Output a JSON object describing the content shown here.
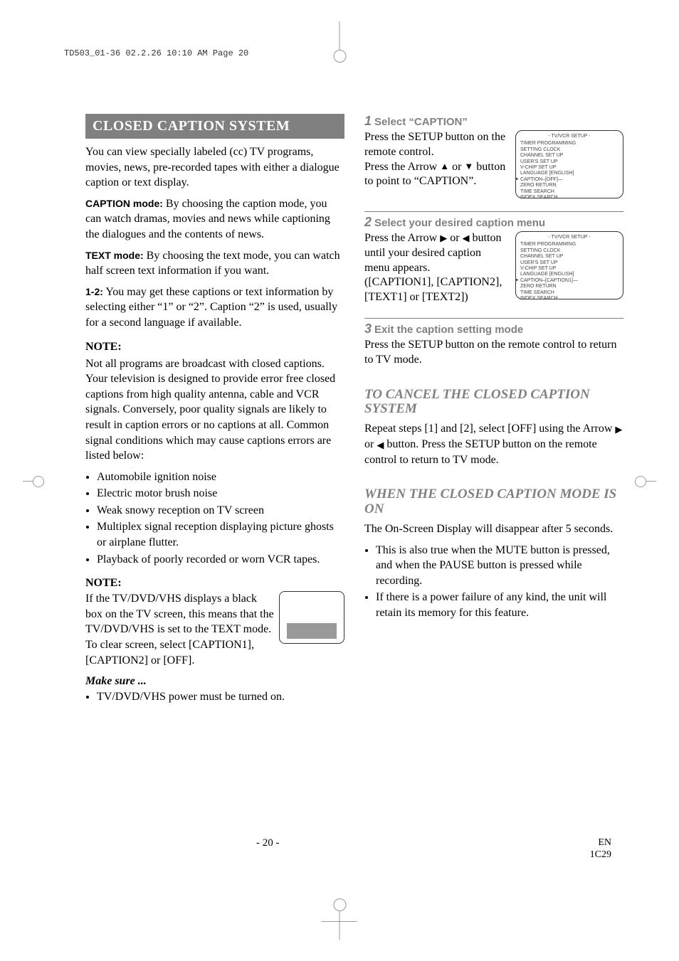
{
  "header_tag": "TD503_01-36  02.2.26  10:10 AM  Page 20",
  "title_bar": "CLOSED CAPTION SYSTEM",
  "intro1": "You can view specially labeled (cc) TV programs, movies, news, pre-recorded tapes with either a dialogue caption or text display.",
  "caption_mode_label": "CAPTION mode:",
  "caption_mode_text": " By choosing the caption mode, you can watch dramas, movies and news while captioning the dialogues and the contents of news.",
  "text_mode_label": "TEXT mode:",
  "text_mode_text": " By choosing the text mode, you can watch half screen text information if you want.",
  "one_two_label": "1-2:",
  "one_two_text": " You may get these captions or text information by selecting either “1” or “2”. Caption “2” is used, usually for a second language if available.",
  "note_label": "NOTE:",
  "note1_text": "Not all programs are broadcast with closed captions. Your television is designed to provide error free closed captions from high quality antenna, cable and VCR signals. Conversely, poor quality signals are likely to result in caption errors or no captions at all. Common signal conditions which may cause captions errors are listed below:",
  "bullets1": [
    "Automobile ignition noise",
    "Electric motor brush noise",
    "Weak snowy reception on TV screen",
    "Multiplex signal reception displaying picture ghosts or airplane flutter.",
    "Playback of poorly recorded or worn VCR tapes."
  ],
  "note2_text": "If the TV/DVD/VHS displays a black box on the TV screen, this means that the TV/DVD/VHS is set to the TEXT mode. To clear screen, select [CAPTION1], [CAPTION2] or [OFF].",
  "make_sure_label": "Make sure ...",
  "make_sure_bullet": "TV/DVD/VHS power must be turned on.",
  "step1_head": "Select “CAPTION”",
  "step1_num": "1",
  "step1_body_a": "Press the SETUP button on the remote control.",
  "step1_body_b_pre": "Press the Arrow ",
  "step1_body_b_post": " button to point to “CAPTION”.",
  "arrow_up": "▲",
  "arrow_down": "▼",
  "arrow_right": "▶",
  "arrow_left": "◀",
  "or_word": " or ",
  "step2_head": "Select your desired caption menu",
  "step2_num": "2",
  "step2_body_pre": "Press the Arrow ",
  "step2_body_post": " button until your desired caption menu appears.",
  "step2_body_extra": "([CAPTION1], [CAPTION2], [TEXT1] or [TEXT2])",
  "step3_head": "Exit the caption setting mode",
  "step3_num": "3",
  "step3_body": "Press the SETUP button on the remote control to return to TV mode.",
  "cancel_head": "TO CANCEL THE CLOSED CAPTION SYSTEM",
  "cancel_body_pre": "Repeat steps [1] and [2], select [OFF] using the Arrow ",
  "cancel_body_post": " button. Press the SETUP button on the remote control to return to TV mode.",
  "whenon_head": "WHEN THE CLOSED CAPTION MODE IS ON",
  "whenon_body": "The On-Screen Display will disappear after 5 seconds.",
  "whenon_bullets": [
    "This is also true when the MUTE button is pressed, and when the PAUSE button is pressed while recording.",
    "If there is a power failure of any kind, the unit will retain its memory for this feature."
  ],
  "osd_title": "- TV/VCR SETUP -",
  "osd1_lines": [
    "TIMER PROGRAMMING",
    "SETTING CLOCK",
    "CHANNEL SET UP",
    "USER'S SET UP",
    "V-CHIP SET UP",
    "LANGUAGE  [ENGLISH]",
    "CAPTION–[OFF]—",
    "ZERO RETURN",
    "TIME SEARCH",
    "INDEX SEARCH"
  ],
  "osd2_lines": [
    "TIMER PROGRAMMING",
    "SETTING CLOCK",
    "CHANNEL SET UP",
    "USER'S SET UP",
    "V-CHIP SET UP",
    "LANGUAGE  [ENGLISH]",
    "CAPTION–[CAPTION1]—",
    "ZERO RETURN",
    "TIME SEARCH",
    "INDEX SEARCH"
  ],
  "footer_page": "- 20 -",
  "footer_en": "EN",
  "footer_code": "1C29"
}
